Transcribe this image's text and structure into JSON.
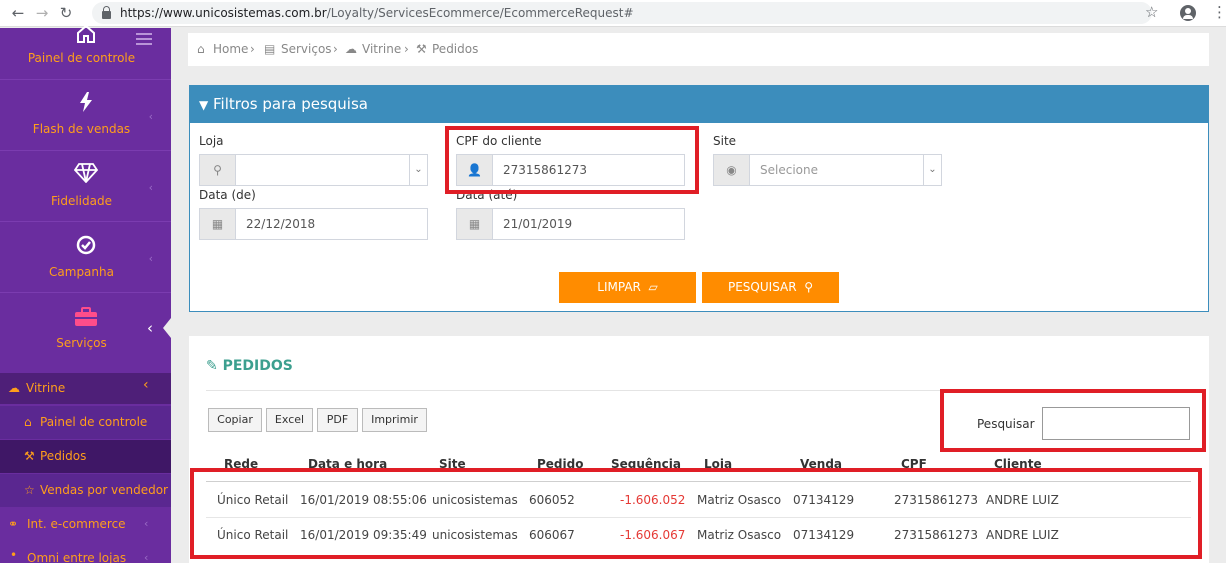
{
  "browser": {
    "url_domain": "https://www.unicosistemas.com.br",
    "url_path": "/Loyalty/ServicesEcommerce/EcommerceRequest#"
  },
  "sidebar": {
    "items": [
      {
        "label": "Painel de controle",
        "icon": "home-icon"
      },
      {
        "label": "Flash de vendas",
        "icon": "lightning-icon"
      },
      {
        "label": "Fidelidade",
        "icon": "diamond-icon"
      },
      {
        "label": "Campanha",
        "icon": "check-circle-icon"
      },
      {
        "label": "Serviços",
        "icon": "briefcase-icon"
      }
    ],
    "submenu_header": "Vitrine",
    "submenu": [
      {
        "label": "Painel de controle",
        "icon": "home-icon"
      },
      {
        "label": "Pedidos",
        "icon": "gavel-icon"
      },
      {
        "label": "Vendas por vendedor",
        "icon": "star-icon"
      },
      {
        "label": "Int. e-commerce",
        "icon": "link-icon"
      },
      {
        "label": "Omni entre lojas",
        "icon": "dot-icon"
      }
    ]
  },
  "breadcrumb": {
    "home": "Home",
    "servicos": "Serviços",
    "vitrine": "Vitrine",
    "pedidos": "Pedidos"
  },
  "filters": {
    "title": "Filtros para pesquisa",
    "loja_label": "Loja",
    "loja_value": "",
    "cpf_label": "CPF do cliente",
    "cpf_value": "27315861273",
    "site_label": "Site",
    "site_placeholder": "Selecione",
    "data_de_label": "Data (de)",
    "data_de_value": "22/12/2018",
    "data_ate_label": "Data (até)",
    "data_ate_value": "21/01/2019",
    "clear_label": "LIMPAR",
    "search_label": "PESQUISAR"
  },
  "orders": {
    "title": "PEDIDOS",
    "buttons": [
      "Copiar",
      "Excel",
      "PDF",
      "Imprimir"
    ],
    "search_label": "Pesquisar",
    "search_value": "",
    "columns": [
      "Rede",
      "Data e hora",
      "Site",
      "Pedido",
      "Sequência",
      "Loja",
      "Venda",
      "CPF",
      "Cliente"
    ],
    "rows": [
      [
        "Único Retail",
        "16/01/2019 08:55:06",
        "unicosistemas",
        "606052",
        "-1.606.052",
        "Matriz Osasco",
        "07134129",
        "27315861273",
        "ANDRE LUIZ"
      ],
      [
        "Único Retail",
        "16/01/2019 09:35:49",
        "unicosistemas",
        "606067",
        "-1.606.067",
        "Matriz Osasco",
        "07134129",
        "27315861273",
        "ANDRE LUIZ"
      ]
    ]
  },
  "colors": {
    "sidebar": "#6a2d9f",
    "accent_orange": "#ff8c00",
    "panel_blue": "#3c8dbc",
    "highlight_red": "#e01e26",
    "negative": "#e53935"
  }
}
